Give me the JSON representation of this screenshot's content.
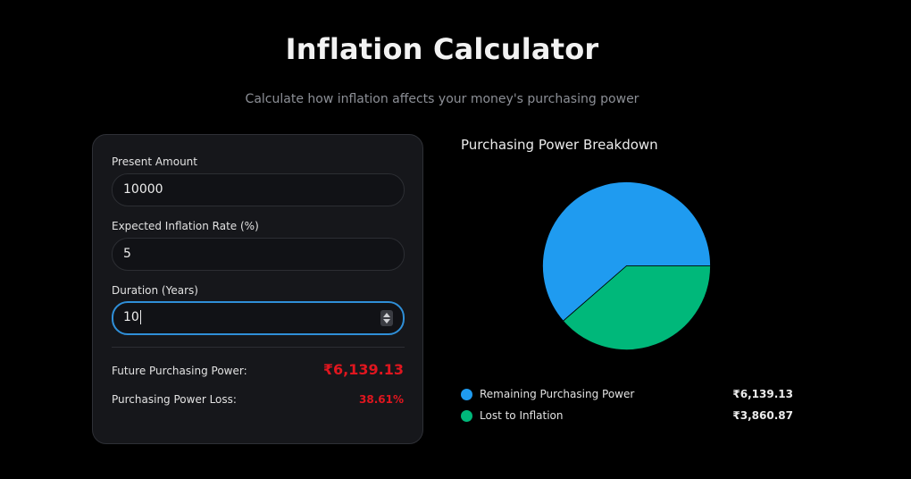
{
  "header": {
    "title": "Inflation Calculator",
    "subtitle": "Calculate how inflation affects your money's purchasing power"
  },
  "form": {
    "present_amount": {
      "label": "Present Amount",
      "value": "10000"
    },
    "inflation_rate": {
      "label": "Expected Inflation Rate (%)",
      "value": "5"
    },
    "duration": {
      "label": "Duration (Years)",
      "value": "10"
    }
  },
  "results": {
    "future_power_label": "Future Purchasing Power:",
    "future_power_value": "₹6,139.13",
    "loss_label": "Purchasing Power Loss:",
    "loss_value": "38.61%"
  },
  "chart_data": {
    "type": "pie",
    "title": "Purchasing Power Breakdown",
    "slices": [
      {
        "label": "Remaining Purchasing Power",
        "value": 6139.13,
        "display": "₹6,139.13",
        "color": "#1f9bf0"
      },
      {
        "label": "Lost to Inflation",
        "value": 3860.87,
        "display": "₹3,860.87",
        "color": "#00b87a"
      }
    ]
  },
  "colors": {
    "background": "#000000",
    "card": "#16171b",
    "accent_focus": "#2f8fd8",
    "result_red": "#e0161f"
  }
}
